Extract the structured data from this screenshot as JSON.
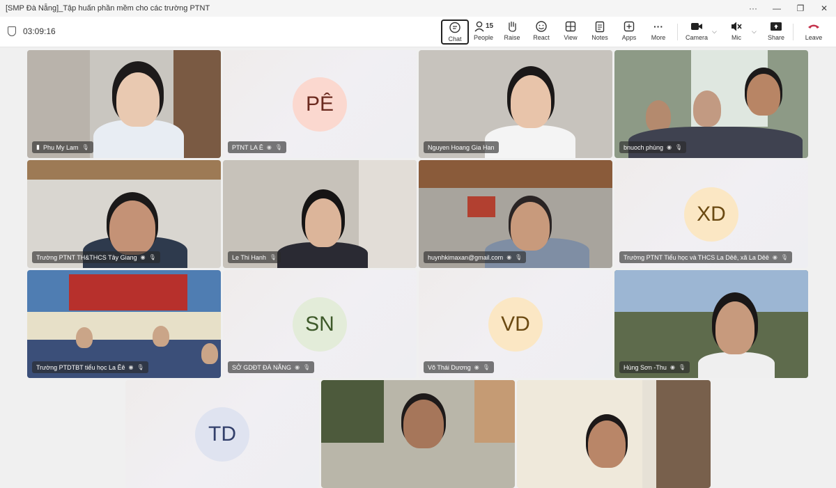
{
  "window": {
    "title": "[SMP Đà Nẵng]_Tập huấn phần mềm cho các trường PTNT",
    "controls": [
      "···",
      "—",
      "❐",
      "✕"
    ]
  },
  "meeting": {
    "elapsed": "03:09:16"
  },
  "toolbar": {
    "chat": "Chat",
    "people": "People",
    "people_count": "15",
    "raise": "Raise",
    "react": "React",
    "view": "View",
    "notes": "Notes",
    "apps": "Apps",
    "more": "More",
    "camera": "Camera",
    "mic": "Mic",
    "share": "Share",
    "leave": "Leave"
  },
  "tiles": [
    {
      "name": "Phu My Lam",
      "type": "video"
    },
    {
      "name": "PTNT LA Ê",
      "type": "avatar",
      "initials": "PÊ",
      "avatar_bg": "#fbd8cf",
      "avatar_fg": "#6b2a1f"
    },
    {
      "name": "Nguyen Hoang Gia Han",
      "type": "video"
    },
    {
      "name": "bnuoch phùng",
      "type": "video"
    },
    {
      "name": "Trường PTNT TH&THCS Tây Giang",
      "type": "video"
    },
    {
      "name": "Le Thi Hanh",
      "type": "video"
    },
    {
      "name": "huynhkimaxan@gmail.com",
      "type": "video"
    },
    {
      "name": "Trường PTNT Tiểu học và THCS La Dêê, xã La Dêê",
      "type": "avatar",
      "initials": "XD",
      "avatar_bg": "#fbe7c4",
      "avatar_fg": "#6b4a12"
    },
    {
      "name": "Trường PTDTBT tiểu học La Êê",
      "type": "video"
    },
    {
      "name": "SỞ GDĐT ĐÀ NẴNG",
      "type": "avatar",
      "initials": "SN",
      "avatar_bg": "#e3ecd9",
      "avatar_fg": "#3e5a2a"
    },
    {
      "name": "Võ Thái Dương",
      "type": "avatar",
      "initials": "VD",
      "avatar_bg": "#fbe7c4",
      "avatar_fg": "#6b4a12"
    },
    {
      "name": "Hùng Sơn -Thu",
      "type": "video"
    },
    {
      "name": "",
      "type": "avatar",
      "initials": "TD",
      "avatar_bg": "#dfe3f0",
      "avatar_fg": "#33406b"
    },
    {
      "name": "",
      "type": "video"
    },
    {
      "name": "",
      "type": "video"
    }
  ]
}
